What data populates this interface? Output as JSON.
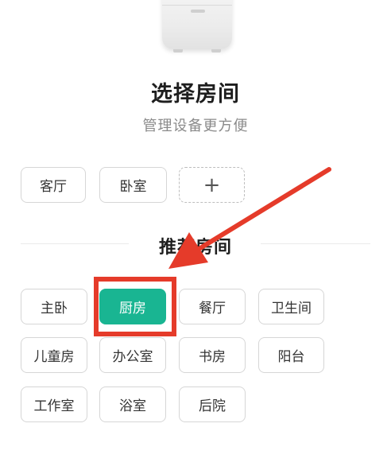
{
  "header": {
    "title": "选择房间",
    "subtitle": "管理设备更方便"
  },
  "my_rooms": {
    "items": [
      {
        "label": "客厅"
      },
      {
        "label": "卧室"
      }
    ],
    "add_label": "+"
  },
  "recommended": {
    "title": "推荐房间",
    "items": [
      {
        "label": "主卧",
        "selected": false
      },
      {
        "label": "厨房",
        "selected": true
      },
      {
        "label": "餐厅",
        "selected": false
      },
      {
        "label": "卫生间",
        "selected": false
      },
      {
        "label": "儿童房",
        "selected": false
      },
      {
        "label": "办公室",
        "selected": false
      },
      {
        "label": "书房",
        "selected": false
      },
      {
        "label": "阳台",
        "selected": false
      },
      {
        "label": "工作室",
        "selected": false
      },
      {
        "label": "浴室",
        "selected": false
      },
      {
        "label": "后院",
        "selected": false
      }
    ]
  },
  "colors": {
    "accent": "#19b592",
    "annotation": "#e53b2a"
  },
  "icons": {
    "device": "smart-device-icon",
    "annotation_arrow": "red-arrow-icon"
  }
}
